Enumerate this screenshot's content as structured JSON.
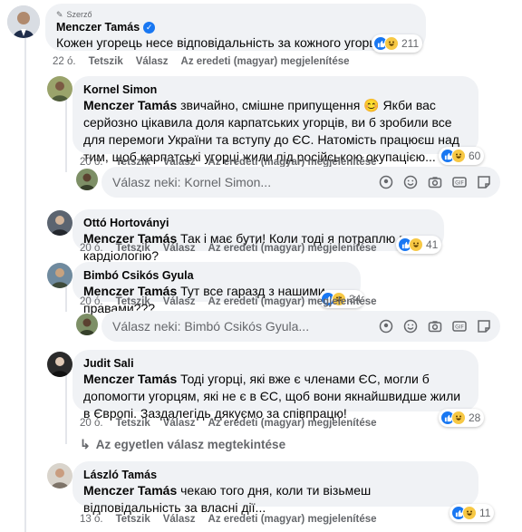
{
  "colors": {
    "bubble": "#f0f2f5",
    "meta": "#65676b",
    "like": "#1877f2",
    "haha": "#f7c844",
    "verified": "#1877f2"
  },
  "icons": {
    "verified": "verified-badge-icon",
    "like": "like-reaction-icon",
    "haha": "haha-reaction-icon",
    "flag": "hungary-flag-icon"
  },
  "main_comment": {
    "author_tag": "Szerző",
    "author": "Menczer Tamás",
    "text": "Кожен угорець несе відповідальність за кожного угорця! 🇭🇺",
    "reactions_count": "211",
    "age": "22 ó.",
    "like_label": "Tetszik",
    "reply_label": "Válasz",
    "translate_label": "Az eredeti (magyar) megjelenítése"
  },
  "replies": [
    {
      "author": "Kornel Simon",
      "mention": "Menczer Tamás",
      "text": "звичайно, смішне припущення 😊 Якби вас серйозно цікавила доля карпатських угорців, ви б зробили все для перемоги України та вступу до ЄС. Натомість працюєш над тим, щоб карпатські угорці жили під російською окупацією...",
      "reactions_count": "60",
      "age": "20 ó.",
      "like_label": "Tetszik",
      "reply_label": "Válasz",
      "translate_label": "Az eredeti (magyar) megjelenítése",
      "reply_placeholder": "Válasz neki: Kornel Simon..."
    },
    {
      "author": "Ottó Hortoványi",
      "mention": "Menczer Tamás",
      "text": "Так і має бути! Коли тоді я потраплю в кардіологію?",
      "reactions_count": "41",
      "age": "20 ó.",
      "like_label": "Tetszik",
      "reply_label": "Válasz",
      "translate_label": "Az eredeti (magyar) megjelenítése"
    },
    {
      "author": "Bimbó Csikós Gyula",
      "mention": "Menczer Tamás",
      "text": "Тут все гаразд з нашими правами???",
      "reactions_count": "34",
      "age": "20 ó.",
      "like_label": "Tetszik",
      "reply_label": "Válasz",
      "translate_label": "Az eredeti (magyar) megjelenítése",
      "reply_placeholder": "Válasz neki: Bimbó Csikós Gyula..."
    },
    {
      "author": "Judit Sali",
      "mention": "Menczer Tamás",
      "text": "Тоді угорці, які вже є членами ЄС, могли б допомогти угорцям, які не є в ЄС, щоб вони якнайшвидше жили в Європі. Заздалегідь дякуємо за співпрацю!",
      "reactions_count": "28",
      "age": "20 ó.",
      "like_label": "Tetszik",
      "reply_label": "Válasz",
      "translate_label": "Az eredeti (magyar) megjelenítése",
      "view_replies_label": "Az egyetlen válasz megtekintése"
    },
    {
      "author": "László Tamás",
      "mention": "Menczer Tamás",
      "text": "чекаю того дня, коли ти візьмеш відповідальність за власні дії...",
      "reactions_count": "11",
      "age": "13 ó.",
      "like_label": "Tetszik",
      "reply_label": "Válasz",
      "translate_label": "Az eredeti (magyar) megjelenítése"
    }
  ]
}
